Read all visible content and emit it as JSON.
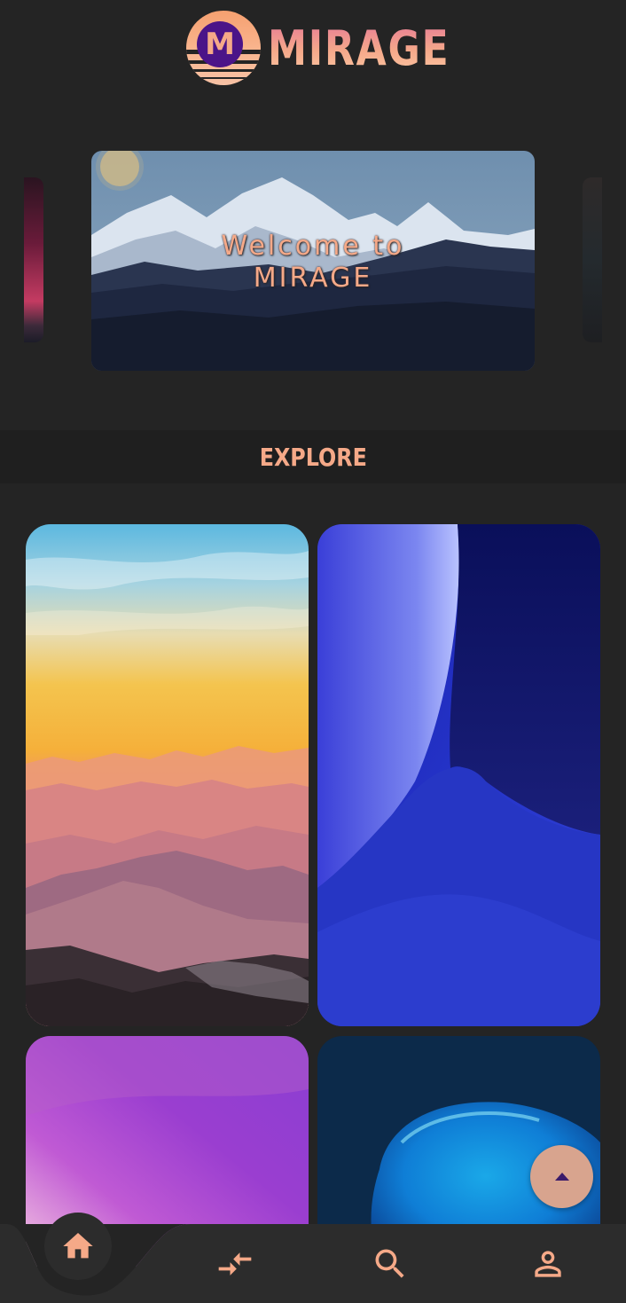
{
  "header": {
    "logo_letter": "M",
    "app_name": "MIRAGE"
  },
  "carousel": {
    "hero_title_line1": "Welcome to",
    "hero_title_line2": "MIRAGE"
  },
  "explore": {
    "title": "EXPLORE"
  },
  "gallery": {
    "items": [
      {
        "name": "sunset-mountains"
      },
      {
        "name": "blue-abstract-waves"
      },
      {
        "name": "purple-gradient"
      },
      {
        "name": "blue-blob"
      }
    ]
  },
  "bottom_nav": {
    "items": [
      {
        "icon": "home-icon",
        "active": true
      },
      {
        "icon": "compare-arrows-icon"
      },
      {
        "icon": "search-icon"
      },
      {
        "icon": "person-icon"
      }
    ]
  },
  "fab": {
    "icon": "arrow-up-icon"
  },
  "colors": {
    "background": "#242424",
    "accent": "#f5a988",
    "logo_purple": "#4b1488",
    "fab": "#d8a48e"
  }
}
